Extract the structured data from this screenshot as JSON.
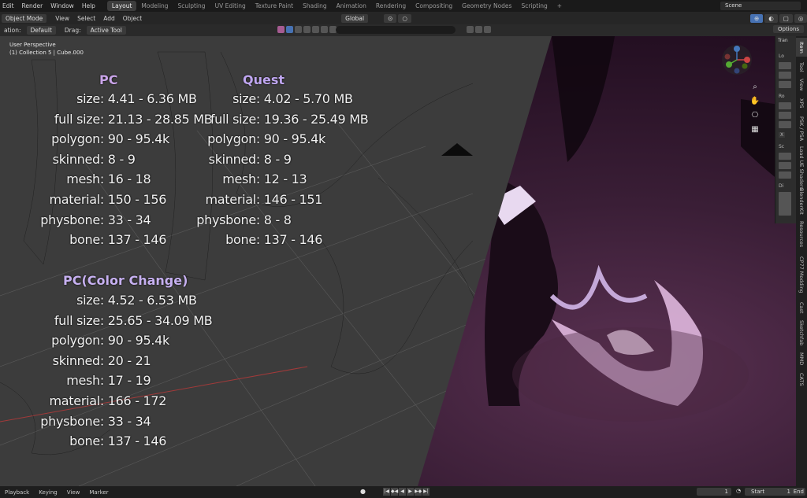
{
  "topbar": {
    "menus": [
      "Edit",
      "Render",
      "Window",
      "Help"
    ],
    "tabs": [
      "Layout",
      "Modeling",
      "Sculpting",
      "UV Editing",
      "Texture Paint",
      "Shading",
      "Animation",
      "Rendering",
      "Compositing",
      "Geometry Nodes",
      "Scripting"
    ],
    "scene": "Scene"
  },
  "header": {
    "mode": "Object Mode",
    "menus": [
      "View",
      "Select",
      "Add",
      "Object"
    ],
    "transform": "Global"
  },
  "tool_header": {
    "ation": "ation:",
    "orientation": "Default",
    "drag_label": "Drag:",
    "drag_value": "Active Tool",
    "options": "Options"
  },
  "viewport": {
    "perspective": "User Perspective",
    "collection": "(1) Collection 5 | Cube.000"
  },
  "stats": {
    "pc": {
      "title": "PC",
      "title_color": "#c9a4e8",
      "rows": [
        {
          "key": "size:",
          "val": "4.41 - 6.36 MB"
        },
        {
          "key": "full size:",
          "val": "21.13 - 28.85 MB"
        },
        {
          "key": "polygon:",
          "val": "90 - 95.4k"
        },
        {
          "key": "skinned:",
          "val": "8 - 9"
        },
        {
          "key": "mesh:",
          "val": "16 - 18"
        },
        {
          "key": "material:",
          "val": "150 - 156"
        },
        {
          "key": "physbone:",
          "val": "33 - 34"
        },
        {
          "key": "bone:",
          "val": "137 - 146"
        }
      ]
    },
    "quest": {
      "title": "Quest",
      "title_color": "#bfa6f0",
      "rows": [
        {
          "key": "size:",
          "val": "4.02 - 5.70 MB"
        },
        {
          "key": "full size:",
          "val": "19.36 - 25.49 MB"
        },
        {
          "key": "polygon:",
          "val": "90 - 95.4k"
        },
        {
          "key": "skinned:",
          "val": "8 - 9"
        },
        {
          "key": "mesh:",
          "val": "12 - 13"
        },
        {
          "key": "material:",
          "val": "146 - 151"
        },
        {
          "key": "physbone:",
          "val": "8 - 8"
        },
        {
          "key": "bone:",
          "val": "137 - 146"
        }
      ]
    },
    "pc_color": {
      "title": "PC(Color Change)",
      "title_color": "#c6b0f0",
      "rows": [
        {
          "key": "size:",
          "val": "4.52 - 6.53 MB"
        },
        {
          "key": "full size:",
          "val": "25.65 - 34.09 MB"
        },
        {
          "key": "polygon:",
          "val": "90 - 95.4k"
        },
        {
          "key": "skinned:",
          "val": "20 - 21"
        },
        {
          "key": "mesh:",
          "val": "17 - 19"
        },
        {
          "key": "material:",
          "val": "166 - 172"
        },
        {
          "key": "physbone:",
          "val": "33 - 34"
        },
        {
          "key": "bone:",
          "val": "137 - 146"
        }
      ]
    }
  },
  "npanel": {
    "tab_label": "Tran",
    "labels": [
      "Lo",
      "Ro",
      "X",
      "Sc",
      "Di"
    ]
  },
  "side_tabs": [
    "Item",
    "Tool",
    "View",
    "XPS",
    "PSK / PSA",
    "Load UE Shaders",
    "BlenderKit",
    "Resources",
    "CP77 Modding",
    "Cast",
    "Sketchfab",
    "MMD",
    "CATS"
  ],
  "timeline": {
    "menus": [
      "Playback",
      "Keying",
      "View",
      "Marker"
    ],
    "current_frame": "1",
    "start_label": "Start",
    "start": "1",
    "end_label": "End"
  },
  "colors": {
    "accent": "#4772b3",
    "grid_red": "#a13a3a"
  }
}
